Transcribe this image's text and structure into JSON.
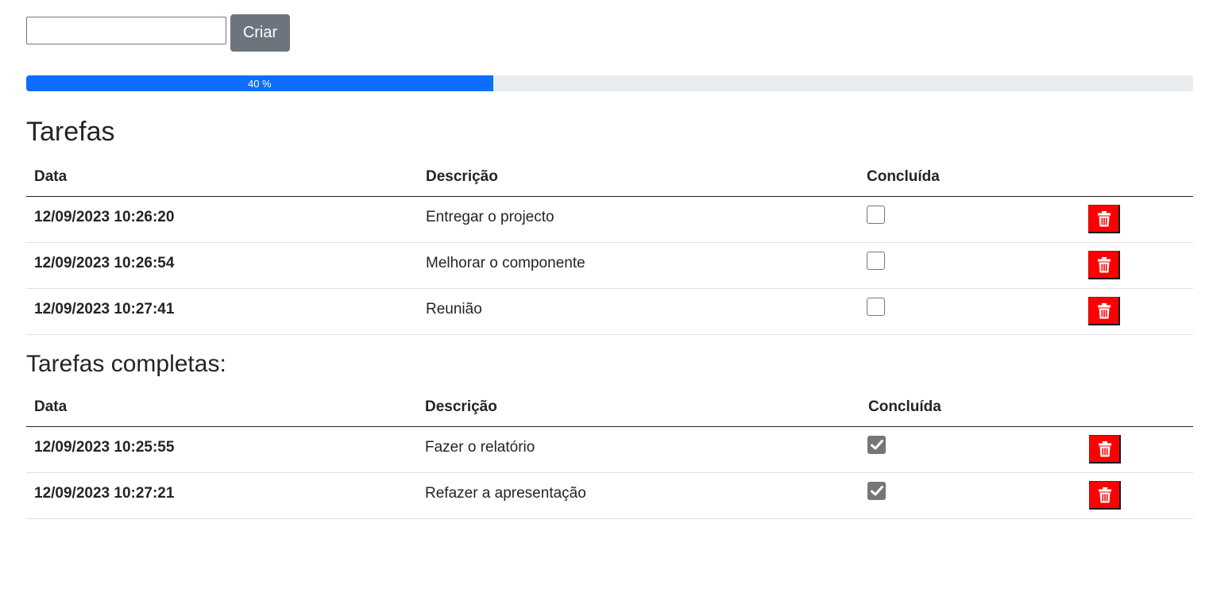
{
  "create": {
    "input_value": "",
    "button_label": "Criar"
  },
  "progress": {
    "value_percent": 40,
    "label": "40 %",
    "color": "#0d6efd"
  },
  "tasks": {
    "title": "Tarefas",
    "headers": {
      "date": "Data",
      "description": "Descrição",
      "done": "Concluída"
    },
    "rows": [
      {
        "date": "12/09/2023 10:26:20",
        "description": "Entregar o projecto",
        "done": false
      },
      {
        "date": "12/09/2023 10:26:54",
        "description": "Melhorar o componente",
        "done": false
      },
      {
        "date": "12/09/2023 10:27:41",
        "description": "Reunião",
        "done": false
      }
    ]
  },
  "completed": {
    "title": "Tarefas completas:",
    "headers": {
      "date": "Data",
      "description": "Descrição",
      "done": "Concluída"
    },
    "rows": [
      {
        "date": "12/09/2023 10:25:55",
        "description": "Fazer o relatório",
        "done": true
      },
      {
        "date": "12/09/2023 10:27:21",
        "description": "Refazer a apresentação",
        "done": true
      }
    ]
  },
  "icons": {
    "delete": "trash-icon",
    "check": "checkmark-icon"
  },
  "colors": {
    "delete_button": "#ff0000",
    "create_button": "#6c757d",
    "checked_box": "#767676"
  }
}
